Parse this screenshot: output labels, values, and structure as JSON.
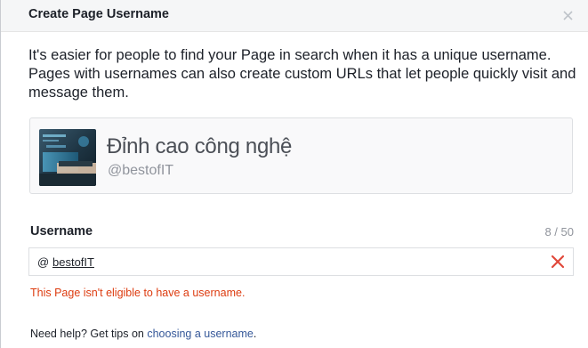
{
  "dialog": {
    "title": "Create Page Username",
    "intro": "It's easier for people to find your Page in search when it has a unique username. Pages with usernames can also create custom URLs that let people quickly visit and message them."
  },
  "preview": {
    "page_name": "Đỉnh cao công nghệ",
    "handle": "@bestofIT"
  },
  "username_field": {
    "label": "Username",
    "counter": "8 / 50",
    "prefix": "@",
    "value": "bestofIT",
    "error": "This Page isn't eligible to have a username."
  },
  "help": {
    "prefix": "Need help? Get tips on ",
    "link_text": "choosing a username",
    "suffix": "."
  },
  "colors": {
    "error_red": "#dd3c10",
    "link_blue": "#365899",
    "clear_icon_red": "#e0483a"
  }
}
